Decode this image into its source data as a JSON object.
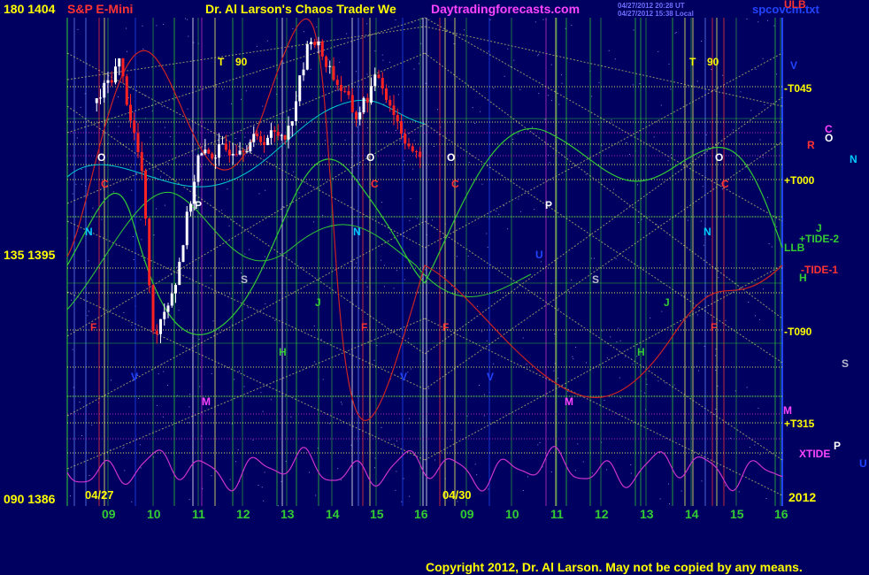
{
  "header": {
    "left_price_top": "180 1404",
    "symbol": "S&P E-Mini",
    "title": "Dr. Al Larson's Chaos Trader We",
    "website": "Daytradingforecasts.com",
    "timestamp_1": "04/27/2012 20:28 UT",
    "timestamp_2": "04/27/2012 15:38 Local",
    "filename": "spcovcm.txt",
    "ulb": "ULB"
  },
  "left_axis": {
    "mid_label": "135 1395",
    "bottom_label": "090 1386"
  },
  "right_labels": {
    "t045": "-T045",
    "t000": "+T000",
    "tide2": "+TIDE-2",
    "llb": "LLB",
    "tide1": "-TIDE-1",
    "t090": "-T090",
    "t315": "+T315",
    "xtide": "XTIDE",
    "year": "2012"
  },
  "planet_glyphs_right": [
    "V",
    "C",
    "R",
    "O",
    "N",
    "J",
    "H",
    "S",
    "M",
    "P",
    "U"
  ],
  "date_labels": [
    "04/27",
    "04/30"
  ],
  "copyright": "Copyright 2012, Dr. Al Larson. May not be copied by any means.",
  "colors": {
    "background": "#000060",
    "price_up": "#ffffff",
    "price_down": "#ff0000",
    "grid_green": "#33cc33",
    "grid_yellow": "#e0e070",
    "xtide": "#cc33cc",
    "gold_text": "#ffff00"
  },
  "chart_data": {
    "type": "candlestick",
    "symbol": "S&P E-Mini",
    "y_price_labels": [
      1386,
      1395,
      1404
    ],
    "y_angle_labels": [
      90,
      135,
      180
    ],
    "x_hour_ticks_day1": [
      "09",
      "10",
      "11",
      "12",
      "13",
      "14",
      "15",
      "16"
    ],
    "x_hour_ticks_day2": [
      "09",
      "10",
      "11",
      "12",
      "13",
      "14",
      "15",
      "16"
    ],
    "sessions": [
      "04/27",
      "04/30"
    ],
    "trend_markers": [
      "T 90",
      "T 90"
    ],
    "approx_close_path": [
      {
        "hour": "08:45",
        "price": 1400.5
      },
      {
        "hour": "09:15",
        "price": 1402.0
      },
      {
        "hour": "09:45",
        "price": 1398.0
      },
      {
        "hour": "10:00",
        "price": 1392.0
      },
      {
        "hour": "10:30",
        "price": 1394.0
      },
      {
        "hour": "11:00",
        "price": 1398.5
      },
      {
        "hour": "12:00",
        "price": 1399.0
      },
      {
        "hour": "13:00",
        "price": 1399.5
      },
      {
        "hour": "13:30",
        "price": 1403.0
      },
      {
        "hour": "14:00",
        "price": 1401.5
      },
      {
        "hour": "14:30",
        "price": 1400.0
      },
      {
        "hour": "15:00",
        "price": 1401.5
      },
      {
        "hour": "15:30",
        "price": 1399.5
      },
      {
        "hour": "16:00",
        "price": 1398.0
      }
    ],
    "grid": true
  }
}
